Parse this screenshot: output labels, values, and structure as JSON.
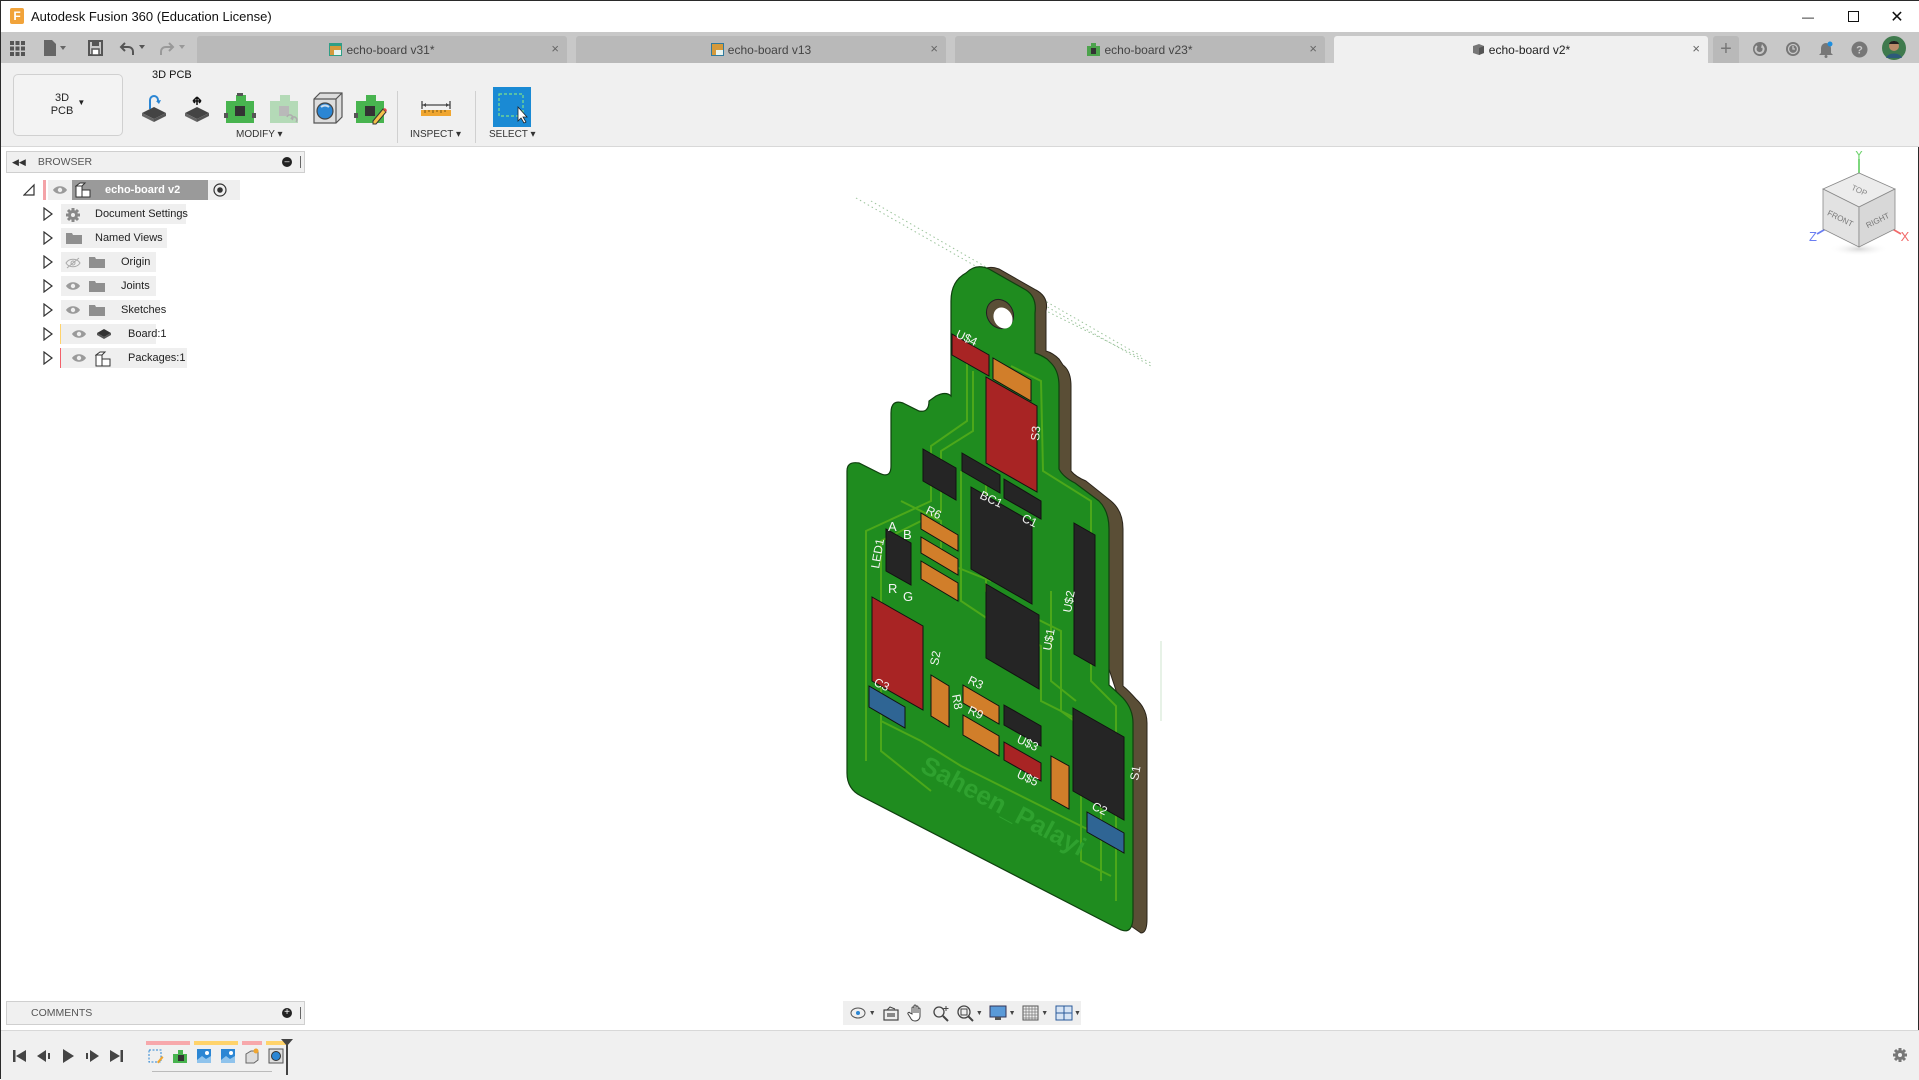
{
  "app": {
    "title": "Autodesk Fusion 360 (Education License)",
    "logo_letter": "F"
  },
  "window_controls": {
    "minimize": "—",
    "maximize": "☐",
    "close": "✕"
  },
  "quick_access": {
    "grid_icon": "apps-grid-icon",
    "file_icon": "file-icon",
    "save_icon": "save-icon",
    "undo_icon": "undo-icon",
    "redo_icon": "redo-icon"
  },
  "tabs": [
    {
      "label": "echo-board v31*",
      "icon": "pcb-doc-icon",
      "active": false
    },
    {
      "label": "echo-board v13",
      "icon": "schematic-doc-icon",
      "active": false
    },
    {
      "label": "echo-board v23*",
      "icon": "board-doc-icon",
      "active": false
    },
    {
      "label": "echo-board v2*",
      "icon": "3d-doc-icon",
      "active": true
    }
  ],
  "tab_close": "×",
  "new_tab": "+",
  "top_right_icons": [
    "extensions-icon",
    "job-status-icon",
    "notifications-icon",
    "help-icon",
    "user-avatar"
  ],
  "ribbon": {
    "workspace_line1": "3D",
    "workspace_line2": "PCB",
    "tab_label": "3D PCB",
    "groups": {
      "modify": "MODIFY ▾",
      "inspect": "INSPECT ▾",
      "select": "SELECT ▾"
    }
  },
  "browser": {
    "title": "BROWSER",
    "root": "echo-board v2",
    "items": [
      {
        "label": "Document Settings",
        "icon": "gear-icon",
        "visible": null
      },
      {
        "label": "Named Views",
        "icon": "folder-icon",
        "visible": null
      },
      {
        "label": "Origin",
        "icon": "folder-icon",
        "visible": false
      },
      {
        "label": "Joints",
        "icon": "folder-icon",
        "visible": true
      },
      {
        "label": "Sketches",
        "icon": "folder-icon",
        "visible": true
      },
      {
        "label": "Board:1",
        "icon": "chip-icon",
        "visible": true,
        "marker": "#ffd36b"
      },
      {
        "label": "Packages:1",
        "icon": "component-icon",
        "visible": true,
        "marker": "#f2606a"
      }
    ]
  },
  "comments": {
    "title": "COMMENTS"
  },
  "timeline": {
    "controls": [
      "go-to-start",
      "step-back",
      "play",
      "step-forward",
      "go-to-end"
    ],
    "features": [
      "sketch-feature",
      "pcb-feature",
      "image-feature",
      "image-feature",
      "new-component-feature",
      "3d-pcb-feature"
    ],
    "group_colors": [
      "#f7a8ab",
      "#ffd36b",
      "#f7a8ab",
      "#ffd36b"
    ]
  },
  "viewcube": {
    "faces": [
      "TOP",
      "FRONT",
      "RIGHT"
    ],
    "axes": {
      "x": "X",
      "y": "Y",
      "z": "Z"
    },
    "axis_colors": {
      "x": "#f26a6a",
      "y": "#6fd36f",
      "z": "#6a7df2"
    }
  },
  "navbar": {
    "icons": [
      "orbit-icon",
      "look-at-icon",
      "pan-icon",
      "zoom-icon",
      "fit-icon",
      "display-settings-icon",
      "grid-icon",
      "viewports-icon"
    ]
  },
  "pcb": {
    "board_color": "#1f8c1f",
    "trace_color": "#4ca81a",
    "edge_color": "#5a4e36",
    "silkscreen_text": "Saheen_Palayi",
    "labels": [
      "U$4",
      "S3",
      "BC1",
      "C1",
      "R6",
      "LED1",
      "A",
      "B",
      "R",
      "G",
      "U$2",
      "U$1",
      "S2",
      "C3",
      "R8",
      "R3",
      "R9",
      "U$3",
      "U$5",
      "S1",
      "C2"
    ],
    "component_colors": {
      "red": "#a82424",
      "orange": "#d17e2a",
      "black": "#252525",
      "blue": "#2f6594"
    }
  }
}
